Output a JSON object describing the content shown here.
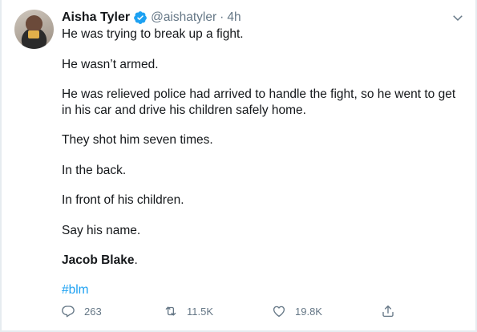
{
  "author": {
    "name": "Aisha Tyler",
    "handle": "@aishatyler",
    "separator": "·",
    "time": "4h"
  },
  "tweet": {
    "paragraphs": [
      "He was trying to break up a fight.",
      "He wasn’t armed.",
      "He was relieved police had  arrived to handle the fight, so he went to get in his car and drive his children safely home.",
      "They shot him seven times.",
      "In the back.",
      "In front of his children.",
      "Say his name."
    ],
    "name_bold": "Jacob Blake",
    "name_suffix": ".",
    "hashtag": "#blm"
  },
  "stats": {
    "replies": "263",
    "retweets": "11.5K",
    "likes": "19.8K"
  },
  "icons": {
    "verified": "verified-badge-icon",
    "menu": "chevron-down-icon",
    "reply": "reply-icon",
    "retweet": "retweet-icon",
    "like": "heart-icon",
    "share": "share-icon"
  },
  "colors": {
    "accent": "#1da1f2",
    "muted": "#657786",
    "text": "#14171a"
  }
}
